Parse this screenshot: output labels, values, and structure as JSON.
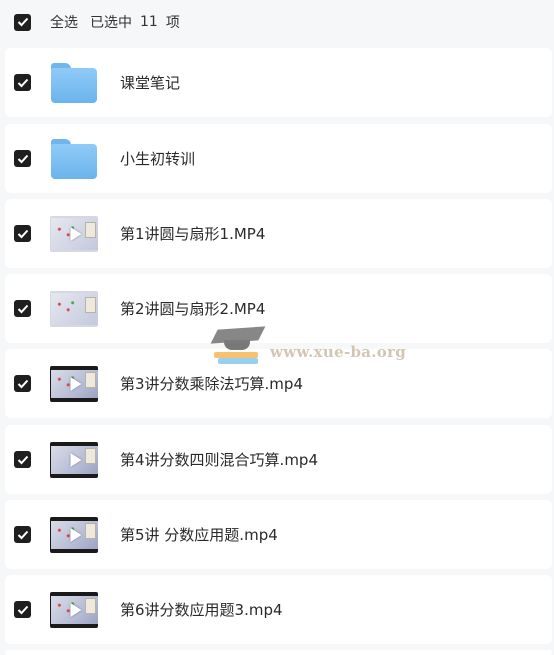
{
  "header": {
    "select_all_label": "全选",
    "selected_prefix": "已选中",
    "selected_count": "11",
    "selected_suffix": "项"
  },
  "files": [
    {
      "name": "课堂笔记",
      "type": "folder",
      "checked": true
    },
    {
      "name": "小生初转训",
      "type": "folder",
      "checked": true
    },
    {
      "name": "第1讲圆与扇形1.MP4",
      "type": "video",
      "checked": true
    },
    {
      "name": "第2讲圆与扇形2.MP4",
      "type": "video",
      "checked": true
    },
    {
      "name": "第3讲分数乘除法巧算.mp4",
      "type": "video",
      "checked": true
    },
    {
      "name": "第4讲分数四则混合巧算.mp4",
      "type": "video",
      "checked": true
    },
    {
      "name": "第5讲 分数应用题.mp4",
      "type": "video",
      "checked": true
    },
    {
      "name": "第6讲分数应用题3.mp4",
      "type": "video",
      "checked": true
    }
  ],
  "watermark": {
    "text": "www.xue-ba.org"
  },
  "colors": {
    "checkbox": "#1f1f1f",
    "folder": "#7cc0f2",
    "background": "#f6f7f9",
    "row": "#ffffff"
  },
  "icons": {
    "checkbox": "check-icon",
    "folder": "folder-icon",
    "video": "video-thumbnail-icon"
  }
}
